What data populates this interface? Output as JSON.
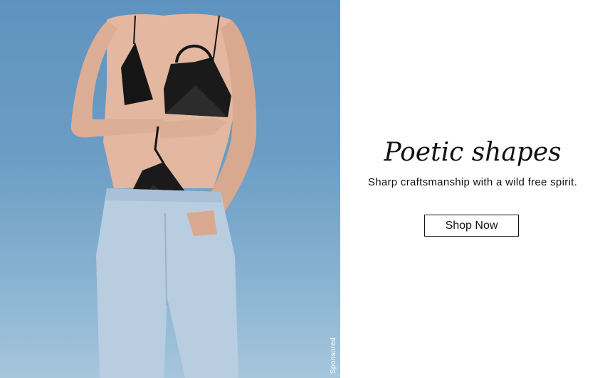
{
  "ad": {
    "headline": "Poetic shapes",
    "subline": "Sharp craftsmanship with a wild free spirit.",
    "cta_label": "Shop Now",
    "sponsored_label": "Sponsored"
  },
  "colors": {
    "background": "#ffffff",
    "text": "#111111",
    "photo_backdrop": "#6b9cc4",
    "denim": "#b9cde0",
    "bag": "#1a1a1a"
  }
}
